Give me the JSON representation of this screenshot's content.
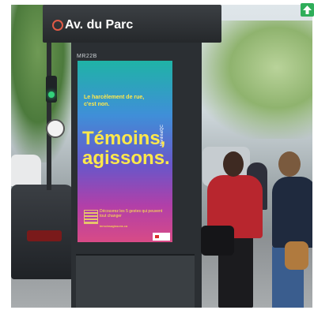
{
  "scene": {
    "kiosk": {
      "street_name": "Av. du Parc",
      "kiosk_code": "MR22B"
    },
    "poster": {
      "headline": "Le harcèlement de rue, c'est non.",
      "slogan": "Témoins, agissons.",
      "fine_print": "Découvrez les 5 gestes qui peuvent tout changer",
      "url": "temoinsagissons.ca",
      "side_text": "MontréalQC"
    },
    "colors": {
      "poster_text": "#ffe94a",
      "kiosk": "#2b2f33",
      "traffic_light": "#33d17a"
    },
    "icons": [
      "logo-icon",
      "qr-code-icon",
      "traffic-light-icon",
      "up-arrow-icon"
    ]
  }
}
